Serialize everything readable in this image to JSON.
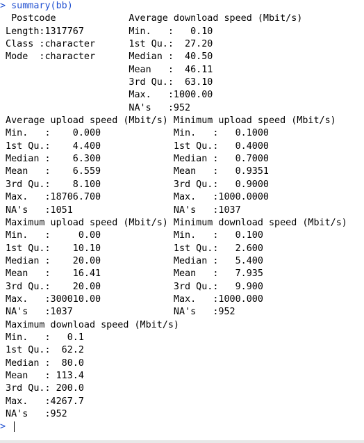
{
  "console": {
    "prev_line": "                 ",
    "command_prompt": "> ",
    "command": "summary(bb)",
    "output_lines": [
      "  Postcode             Average download speed (Mbit/s)",
      " Length:1317767        Min.   :   0.10                ",
      " Class :character      1st Qu.:  27.20                ",
      " Mode  :character      Median :  40.50                ",
      "                       Mean   :  46.11                ",
      "                       3rd Qu.:  63.10                ",
      "                       Max.   :1000.00                ",
      "                       NA's   :952                    ",
      " Average upload speed (Mbit/s) Minimum upload speed (Mbit/s)",
      " Min.   :    0.000             Min.   :   0.1000          ",
      " 1st Qu.:    4.400             1st Qu.:   0.4000          ",
      " Median :    6.300             Median :   0.7000          ",
      " Mean   :    6.559             Mean   :   0.9351          ",
      " 3rd Qu.:    8.100             3rd Qu.:   0.9000          ",
      " Max.   :18706.700             Max.   :1000.0000          ",
      " NA's   :1051                  NA's   :1037               ",
      " Maximum upload speed (Mbit/s) Minimum download speed (Mbit/s)",
      " Min.   :     0.00             Min.   :   0.100           ",
      " 1st Qu.:    10.10             1st Qu.:   2.600           ",
      " Median :    20.00             Median :   5.400           ",
      " Mean   :    16.41             Mean   :   7.935           ",
      " 3rd Qu.:    20.00             3rd Qu.:   9.900           ",
      " Max.   :300010.00             Max.   :1000.000           ",
      " NA's   :1037                  NA's   :952                ",
      " Maximum download speed (Mbit/s)",
      " Min.   :   0.1                ",
      " 1st Qu.:  62.2                ",
      " Median :  80.0                ",
      " Mean   : 113.4                ",
      " 3rd Qu.: 200.0                ",
      " Max.   :4267.7                ",
      " NA's   :952                   "
    ],
    "input_prompt": "> ",
    "input_value": ""
  }
}
